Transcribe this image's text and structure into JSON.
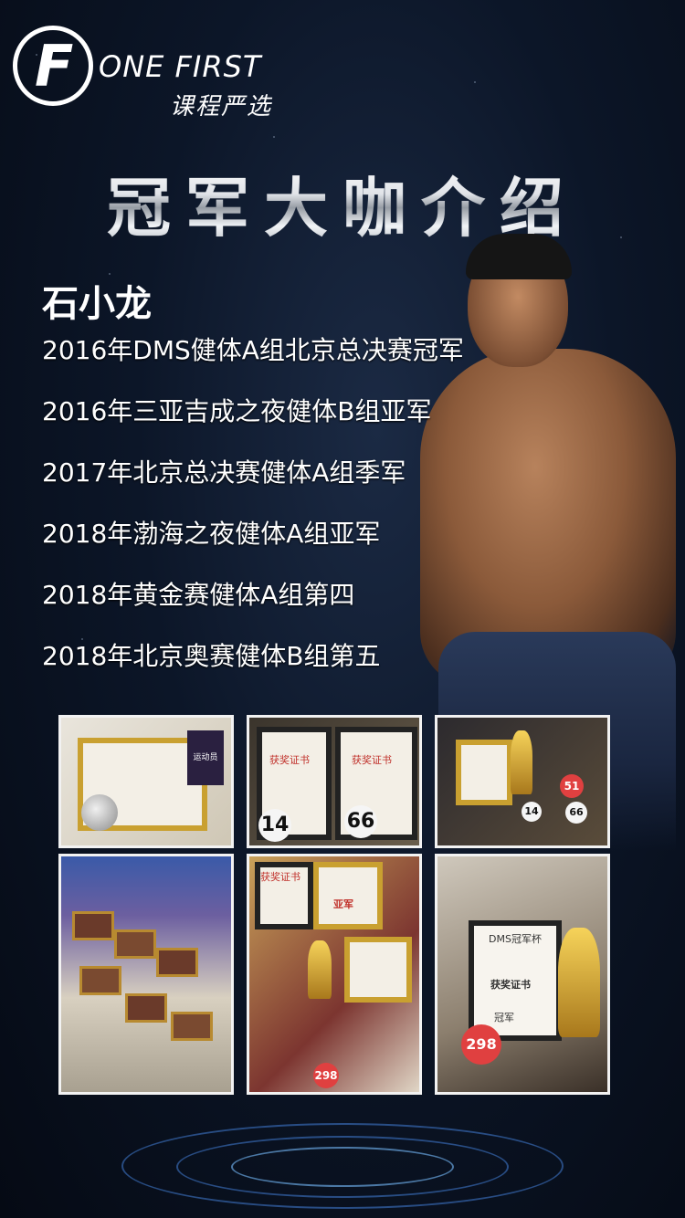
{
  "logo": {
    "letter": "F",
    "brand": "ONE FIRST",
    "subtitle": "课程严选"
  },
  "title": "冠军大咖介绍",
  "name": "石小龙",
  "awards": [
    "2016年DMS健体A组北京总决赛冠军",
    "2016年三亚吉成之夜健体B组亚军",
    "2017年北京总决赛健体A组季军",
    "2018年渤海之夜健体A组亚军",
    "2018年黄金赛健体A组第四",
    "2018年北京奥赛健体B组第五"
  ],
  "photos": {
    "p1": {
      "book_label": "运动员"
    },
    "p2": {
      "cert1": "获奖证书",
      "cert2": "获奖证书",
      "tag1": "14",
      "tag2": "66"
    },
    "p3": {
      "tag1": "51",
      "tag2": "14",
      "tag3": "66"
    },
    "p5": {
      "cert": "获奖证书",
      "place": "亚军",
      "tag": "298"
    },
    "p6": {
      "header": "DMS冠军杯",
      "cert": "获奖证书",
      "place": "冠军",
      "tag": "298"
    }
  },
  "colors": {
    "background": "#0c1628",
    "text": "#ffffff",
    "frame_gold": "#c9a030",
    "cert_red": "#c0302a"
  }
}
